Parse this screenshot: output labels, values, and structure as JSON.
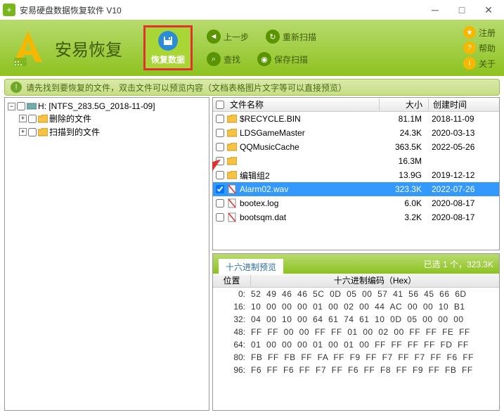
{
  "window": {
    "title": "安易硬盘数据恢复软件 V10"
  },
  "logo": {
    "text": "安易恢复"
  },
  "recover": {
    "label": "恢复数据"
  },
  "toolbar": {
    "prev": "上一步",
    "rescan": "重新扫描",
    "find": "查找",
    "save": "保存扫描"
  },
  "right_btns": {
    "reg": "注册",
    "help": "帮助",
    "about": "关于"
  },
  "hint": {
    "text": "请先找到要恢复的文件，双击文件可以预览内容（文档表格图片文字等可以直接预览）"
  },
  "tree": {
    "root": "H: [NTFS_283.5G_2018-11-09]",
    "deleted": "删除的文件",
    "scanned": "扫描到的文件"
  },
  "files": {
    "head": {
      "name": "文件名称",
      "size": "大小",
      "time": "创建时间"
    },
    "rows": [
      {
        "name": "$RECYCLE.BIN",
        "size": "81.1M",
        "time": "2018-11-09",
        "type": "folder",
        "checked": false
      },
      {
        "name": "LDSGameMaster",
        "size": "24.3K",
        "time": "2020-03-13",
        "type": "folder",
        "checked": false
      },
      {
        "name": "QQMusicCache",
        "size": "363.5K",
        "time": "2022-05-26",
        "type": "folder",
        "checked": false
      },
      {
        "name": "",
        "size": "16.3M",
        "time": "",
        "type": "folder",
        "checked": false
      },
      {
        "name": "编辑组2",
        "size": "13.9G",
        "time": "2019-12-12",
        "type": "folder",
        "checked": false
      },
      {
        "name": "Alarm02.wav",
        "size": "323.3K",
        "time": "2022-07-26",
        "type": "file-del",
        "checked": true,
        "selected": true
      },
      {
        "name": "bootex.log",
        "size": "6.0K",
        "time": "2020-08-17",
        "type": "file-del",
        "checked": false
      },
      {
        "name": "bootsqm.dat",
        "size": "3.2K",
        "time": "2020-08-17",
        "type": "file-del",
        "checked": false
      }
    ]
  },
  "hex": {
    "tab": "十六进制预览",
    "status": "已选 1 个，323.3K",
    "pos_h": "位置",
    "data_h": "十六进制编码（Hex）",
    "rows": [
      {
        "pos": "0:",
        "bytes": "52  49  46  46  5C  0D  05  00  57  41  56  45  66  6D"
      },
      {
        "pos": "16:",
        "bytes": "10  00  00  00  01  00  02  00  44  AC  00  00  10  B1"
      },
      {
        "pos": "32:",
        "bytes": "04  00  10  00  64  61  74  61  10  0D  05  00  00  00"
      },
      {
        "pos": "48:",
        "bytes": "FF  FF  00  00  FF  FF  01  00  02  00  FF  FF  FE  FF"
      },
      {
        "pos": "64:",
        "bytes": "01  00  00  00  01  00  01  00  FF  FF  FF  FF  FD  FF"
      },
      {
        "pos": "80:",
        "bytes": "FB  FF  FB  FF  FA  FF  F9  FF  F7  FF  F7  FF  F6  FF"
      },
      {
        "pos": "96:",
        "bytes": "F6  FF  F6  FF  F7  FF  F6  FF  F8  FF  F9  FF  FB  FF"
      }
    ]
  }
}
